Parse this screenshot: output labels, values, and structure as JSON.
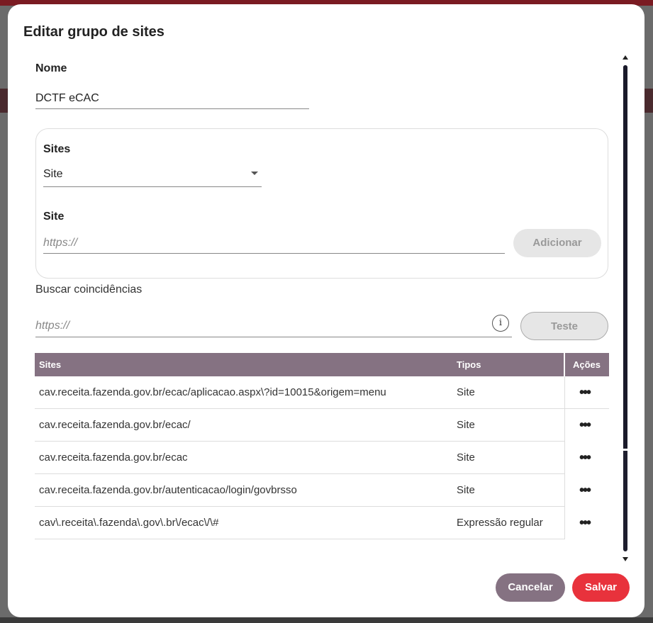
{
  "dialog": {
    "title": "Editar grupo de sites"
  },
  "name_section": {
    "label": "Nome",
    "value": "DCTF eCAC"
  },
  "sites_box": {
    "label": "Sites",
    "type_select_value": "Site",
    "site_label": "Site",
    "site_placeholder": "https://",
    "add_button": "Adicionar"
  },
  "search": {
    "label": "Buscar coincidências",
    "placeholder": "https://",
    "info_icon": "info-icon",
    "test_button": "Teste"
  },
  "table": {
    "headers": {
      "sites": "Sites",
      "types": "Tipos",
      "actions": "Ações"
    },
    "rows": [
      {
        "site": "cav.receita.fazenda.gov.br/ecac/aplicacao.aspx\\?id=10015&origem=menu",
        "type": "Site",
        "action": "•••"
      },
      {
        "site": "cav.receita.fazenda.gov.br/ecac/",
        "type": "Site",
        "action": "•••"
      },
      {
        "site": "cav.receita.fazenda.gov.br/ecac",
        "type": "Site",
        "action": "•••"
      },
      {
        "site": "cav.receita.fazenda.gov.br/autenticacao/login/govbrsso",
        "type": "Site",
        "action": "•••"
      },
      {
        "site": "cav\\.receita\\.fazenda\\.gov\\.br\\/ecac\\/\\#",
        "type": "Expressão regular",
        "action": "•••"
      }
    ]
  },
  "footer": {
    "cancel_button": "Cancelar",
    "save_button": "Salvar"
  },
  "colors": {
    "header_bg": "#857282",
    "save_bg": "#e8323c",
    "cancel_bg": "#857282"
  }
}
